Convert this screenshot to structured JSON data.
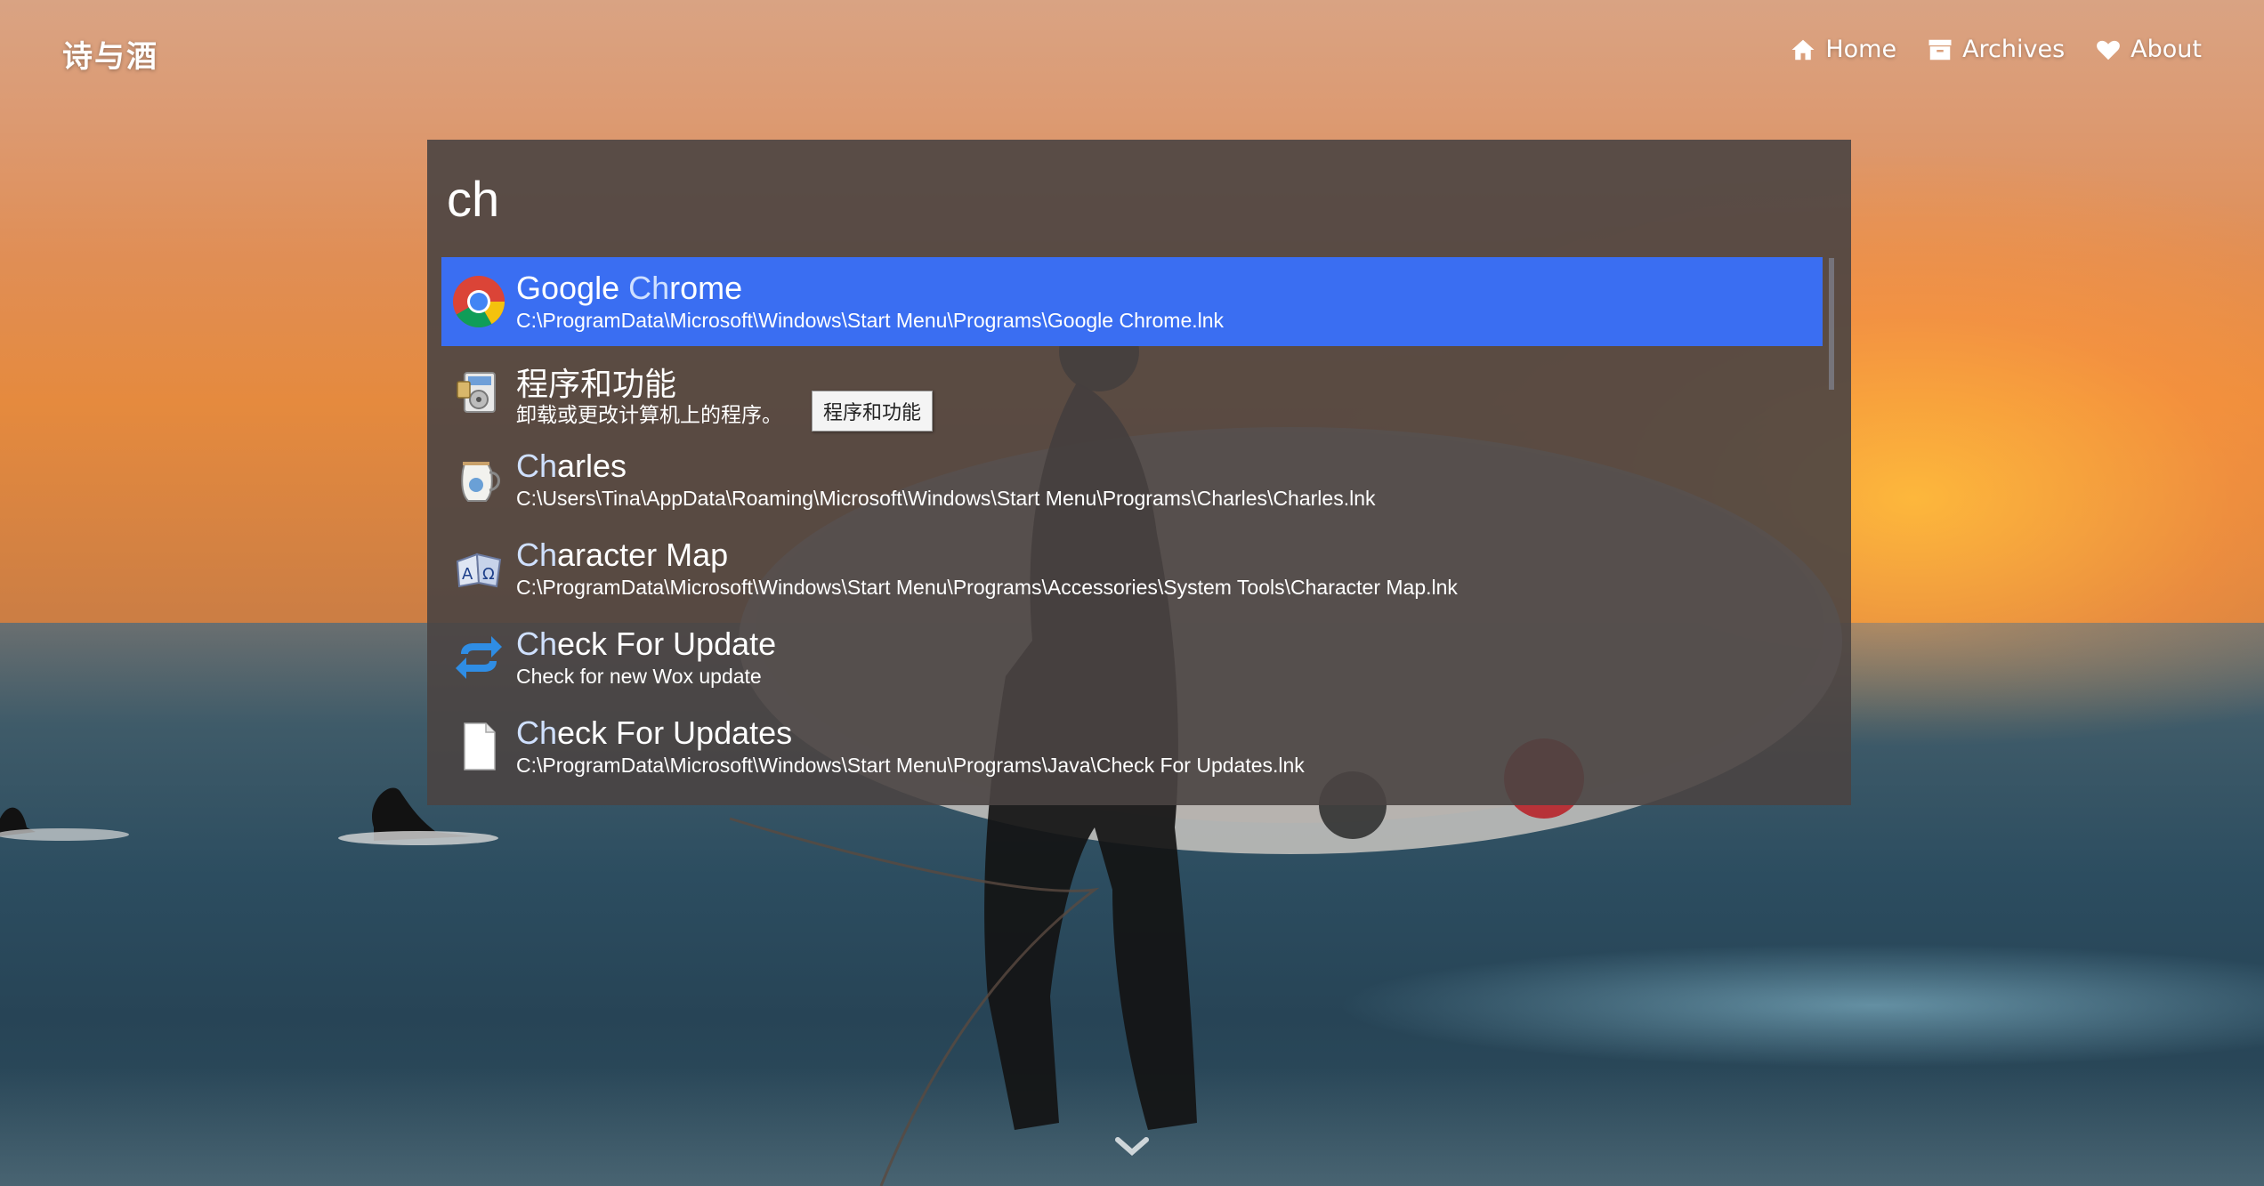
{
  "site": {
    "title": "诗与酒",
    "nav": [
      {
        "label": "Home",
        "icon": "home-icon"
      },
      {
        "label": "Archives",
        "icon": "archive-icon"
      },
      {
        "label": "About",
        "icon": "heart-icon"
      }
    ]
  },
  "launcher": {
    "query": "ch",
    "selected_index": 0,
    "accent_color": "#3a6ef2",
    "results": [
      {
        "title_pre": "Google ",
        "title_hl": "Ch",
        "title_post": "rome",
        "subtitle": "C:\\ProgramData\\Microsoft\\Windows\\Start Menu\\Programs\\Google Chrome.lnk",
        "icon": "chrome-icon"
      },
      {
        "title_pre": "",
        "title_hl": "",
        "title_post": "程序和功能",
        "subtitle": "卸载或更改计算机上的程序。",
        "icon": "programs-features-icon",
        "tooltip": "程序和功能"
      },
      {
        "title_pre": "",
        "title_hl": "Ch",
        "title_post": "arles",
        "subtitle": "C:\\Users\\Tina\\AppData\\Roaming\\Microsoft\\Windows\\Start Menu\\Programs\\Charles\\Charles.lnk",
        "icon": "charles-jug-icon"
      },
      {
        "title_pre": "",
        "title_hl": "Ch",
        "title_post": "aracter Map",
        "subtitle": "C:\\ProgramData\\Microsoft\\Windows\\Start Menu\\Programs\\Accessories\\System Tools\\Character Map.lnk",
        "icon": "character-map-icon"
      },
      {
        "title_pre": "",
        "title_hl": "Ch",
        "title_post": "eck For Update",
        "subtitle": "Check for new Wox update",
        "icon": "update-arrows-icon"
      },
      {
        "title_pre": "",
        "title_hl": "Ch",
        "title_post": "eck For Updates",
        "subtitle": "C:\\ProgramData\\Microsoft\\Windows\\Start Menu\\Programs\\Java\\Check For Updates.lnk",
        "icon": "file-icon"
      }
    ]
  }
}
